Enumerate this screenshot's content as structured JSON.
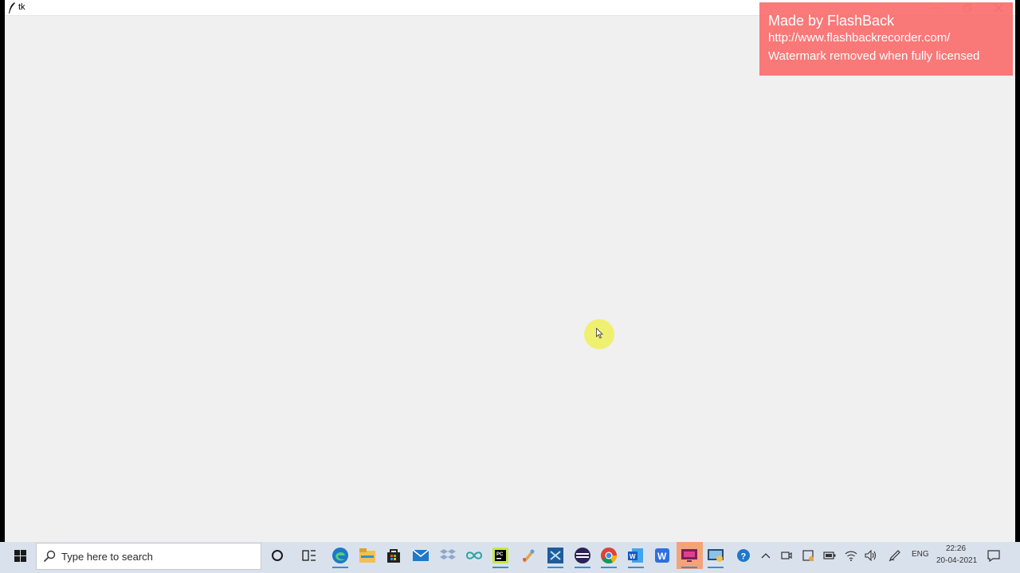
{
  "window": {
    "title": "tk"
  },
  "watermark": {
    "line1": "Made by FlashBack",
    "line2": "http://www.flashbackrecorder.com/",
    "line3": "Watermark removed when fully licensed"
  },
  "taskbar": {
    "search_placeholder": "Type here to search",
    "pinned_apps": [
      "cortana-icon",
      "task-view-icon",
      "edge-icon",
      "file-explorer-icon",
      "store-icon",
      "mail-icon",
      "dropbox-icon",
      "arduino-icon",
      "pycharm-icon",
      "paint-icon",
      "vscode-icon",
      "eclipse-icon",
      "chrome-icon",
      "word-icon",
      "wps-icon",
      "recorder-icon",
      "screen-capture-icon"
    ],
    "tray": {
      "language": "ENG",
      "time": "22:26",
      "date": "20-04-2021"
    }
  },
  "colors": {
    "window_bg": "#f0f0f0",
    "watermark_bg": "#fa6e6e",
    "taskbar_bg": "#d9e2ec",
    "accent": "#3a8bd8"
  }
}
